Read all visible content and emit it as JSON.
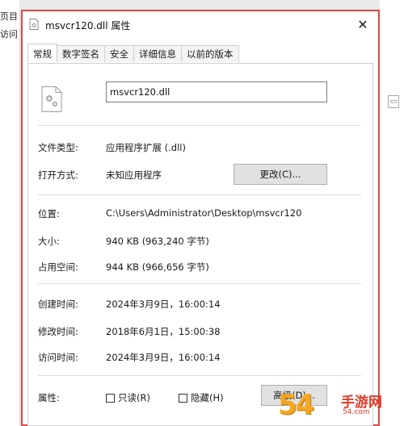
{
  "background": {
    "left_fragments": [
      "页目",
      "访问"
    ]
  },
  "dialog": {
    "title": "msvcr120.dll 属性",
    "close_glyph": "✕",
    "tabs": [
      {
        "label": "常规",
        "active": true
      },
      {
        "label": "数字签名",
        "active": false
      },
      {
        "label": "安全",
        "active": false
      },
      {
        "label": "详细信息",
        "active": false
      },
      {
        "label": "以前的版本",
        "active": false
      }
    ],
    "file_name": "msvcr120.dll",
    "rows": {
      "type_label": "文件类型:",
      "type_value": "应用程序扩展 (.dll)",
      "open_label": "打开方式:",
      "open_value": "未知应用程序",
      "change_button": "更改(C)...",
      "location_label": "位置:",
      "location_value": "C:\\Users\\Administrator\\Desktop\\msvcr120",
      "size_label": "大小:",
      "size_value": "940 KB (963,240 字节)",
      "disk_label": "占用空间:",
      "disk_value": "944 KB (966,656 字节)",
      "created_label": "创建时间:",
      "created_value": "2024年3月9日，16:00:14",
      "modified_label": "修改时间:",
      "modified_value": "2018年6月1日，15:00:38",
      "accessed_label": "访问时间:",
      "accessed_value": "2024年3月9日，16:00:14",
      "attr_label": "属性:",
      "readonly_label": "只读(R)",
      "hidden_label": "隐藏(H)",
      "advanced_button": "高级(D)..."
    }
  },
  "watermark": {
    "number": "54",
    "text": "手游网",
    "domain": "54.com"
  },
  "colors": {
    "highlight_border": "#d44a4a",
    "watermark_orange": "#f5a623",
    "watermark_red": "#e23a2a"
  }
}
